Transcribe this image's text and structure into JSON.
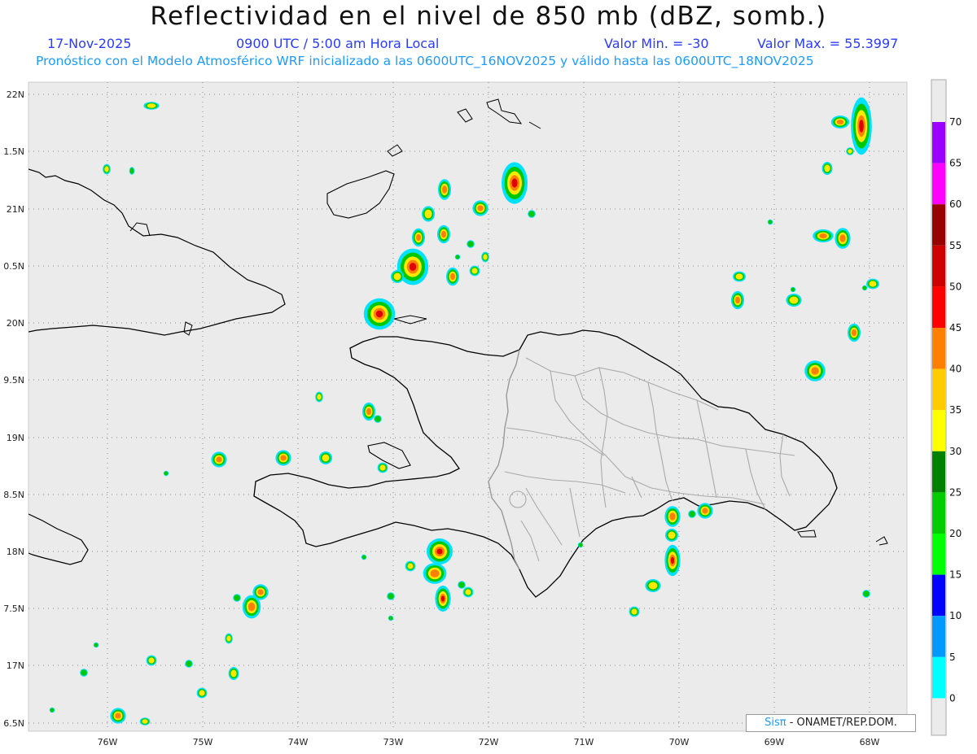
{
  "header": {
    "title": "Reflectividad en el nivel de 850 mb (dBZ, somb.)",
    "date": "17-Nov-2025",
    "time": "0900 UTC / 5:00 am Hora Local",
    "min_label": "Valor Min. = -30",
    "max_label": "Valor Max. = 55.3997",
    "subtitle": "Pronóstico con el Modelo Atmosférico WRF inicializado a las 0600UTC_16NOV2025 y válido hasta las  0600UTC_18NOV2025"
  },
  "axes": {
    "lat_ticks": [
      "22N",
      "1.5N",
      "21N",
      "0.5N",
      "20N",
      "9.5N",
      "19N",
      "8.5N",
      "18N",
      "7.5N",
      "17N",
      "6.5N"
    ],
    "lon_ticks": [
      "76W",
      "75W",
      "74W",
      "73W",
      "72W",
      "71W",
      "70W",
      "69W",
      "68W"
    ]
  },
  "colorbar": {
    "labels": [
      "70",
      "65",
      "60",
      "55",
      "50",
      "45",
      "40",
      "35",
      "30",
      "25",
      "20",
      "15",
      "10",
      "5",
      "0"
    ],
    "colors": [
      "#9900ff",
      "#ff00ff",
      "#990000",
      "#cc0000",
      "#ff0000",
      "#ff8000",
      "#ffcc00",
      "#ffff00",
      "#008000",
      "#00cc00",
      "#00ff00",
      "#0000ff",
      "#0099ff",
      "#00ffff"
    ]
  },
  "credit": {
    "brand": "Sisπ",
    "text": " - ONAMET/REP.DOM."
  }
}
